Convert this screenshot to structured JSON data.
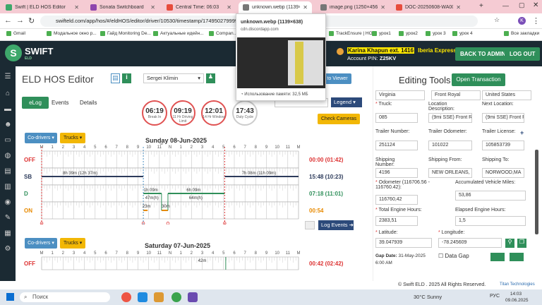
{
  "tabs": [
    {
      "label": "Swift | ELD HOS Editor",
      "color": "#3ea86b",
      "active": false
    },
    {
      "label": "Sonata Switchboard",
      "color": "#8e44ad",
      "active": false
    },
    {
      "label": "Central Time: 06:03",
      "color": "#e74c3c",
      "active": false
    },
    {
      "label": "unknown.webp (1139×638)",
      "color": "#777",
      "active": true
    },
    {
      "label": "image.png (1250×456)",
      "color": "#777",
      "active": false
    },
    {
      "label": "DOC-20250608-WA0003.pdf",
      "color": "#e74c3c",
      "active": false
    }
  ],
  "url": "swifteld.com/app/hos/#/eldHOS/editor/driver/10530/timestamp/1749502799999/",
  "bookmarks": [
    "Gmail",
    "Модальное окно р...",
    "Гайд Monitoring De...",
    "Актуальные идейн...",
    "Compan...",
    "TrackEnsure | HOS",
    "урок1",
    "урок2",
    "урок 3",
    "урок 4",
    "Все закладки"
  ],
  "header": {
    "logo": "SWIFT",
    "logo_sub": "ELD",
    "user": "Karina Khapun ext. 1416",
    "company": "Iberia Express Inc.",
    "pin_label": "Account PIN:",
    "pin": "Z25KV",
    "back_btn": "BACK TO ADMIN",
    "logout_btn": "LOG OUT"
  },
  "popup": {
    "title": "unknown.webp (1139×638)",
    "domain": "cdn.discordapp.com",
    "memory": "Использование памяти: 32,5 МБ"
  },
  "editor": {
    "title": "ELD HOS Editor",
    "driver": "Sergei Klimin",
    "to_viewer": "to Viewer",
    "tabs": [
      "eLog",
      "Events",
      "Details"
    ],
    "legend": "Legend",
    "check_cameras": "Check Cameras",
    "log_events": "Log Events"
  },
  "rings": [
    {
      "v": "06:19",
      "l": "Break In"
    },
    {
      "v": "09:19",
      "l": "11 Hr Driving Limit"
    },
    {
      "v": "12:01",
      "l": "14 Hr Window"
    },
    {
      "v": "17:43",
      "l": "Duty Cycle"
    }
  ],
  "day1": {
    "title": "Sunday 08-Jun-2025",
    "codrivers": "Co-drivers",
    "trucks": "Trucks",
    "rows": [
      "OFF",
      "SB",
      "D",
      "ON"
    ],
    "totals": [
      "00:00 (01:42)",
      "15:48 (10:23)",
      "07:18 (11:01)",
      "00:54"
    ],
    "labels": [
      "8h 39m (12h 37m)",
      "7h 08m (11h 09m)",
      "1h 09m",
      "6h 09m",
      "47m(h)",
      "64m(h)",
      "23m",
      "30m"
    ]
  },
  "day2": {
    "title": "Saturday 07-Jun-2025",
    "codrivers": "Co-drivers",
    "trucks": "Trucks",
    "rows": [
      "OFF"
    ],
    "totals": [
      "00:42 (02:42)"
    ],
    "labels": [
      "42m"
    ]
  },
  "hours": [
    "M",
    "1",
    "2",
    "3",
    "4",
    "5",
    "6",
    "7",
    "8",
    "9",
    "10",
    "11",
    "N",
    "1",
    "2",
    "3",
    "4",
    "5",
    "6",
    "7",
    "8",
    "9",
    "10",
    "11",
    "M"
  ],
  "right": {
    "title": "Editing Tools",
    "open_btn": "Open Transaction",
    "top": [
      "Virginia",
      "Front Royal",
      "United States"
    ],
    "fields": [
      {
        "label": "Truck:",
        "value": "085",
        "req": true
      },
      {
        "label": "Location Description:",
        "value": "(9mi SSE) Front R"
      },
      {
        "label": "Next Location:",
        "value": "(9mi SSE) Front R"
      },
      {
        "label": "Trailer Number:",
        "value": "251124"
      },
      {
        "label": "Trailer Odometer:",
        "value": "101022"
      },
      {
        "label": "Trailer License:",
        "value": "105853739"
      },
      {
        "label": "Shipping Number:",
        "value": "4196"
      },
      {
        "label": "Shipping From:",
        "value": "NEW ORLEANS, L"
      },
      {
        "label": "Shipping To:",
        "value": "NORWOOD,MA"
      },
      {
        "label": "Odometer (116706.56 - 116760.42):",
        "value": "116760,42",
        "req": true
      },
      {
        "label": "Accumulated Vehicle Miles:",
        "value": "53,86"
      },
      {
        "label": "Total Engine Hours:",
        "value": "2383,51",
        "req": true
      },
      {
        "label": "Elapsed Engine Hours:",
        "value": "1,5"
      },
      {
        "label": "Latitude:",
        "value": "39.047939",
        "req": true
      },
      {
        "label": "Longitude:",
        "value": "-78.245609",
        "req": true
      }
    ],
    "gap_label": "Gap Date:",
    "gap_date": "31-May-2025 6:00 AM",
    "data_gap": "Data Gap",
    "footer": "© Swift ELD . 2025 All Rights Reserved.",
    "footer2": "Titan Technologies"
  },
  "taskbar": {
    "search": "Поиск",
    "weather": "30°C Sunny",
    "lang": "РУС",
    "time": "14:03",
    "date": "09.06.2025"
  }
}
